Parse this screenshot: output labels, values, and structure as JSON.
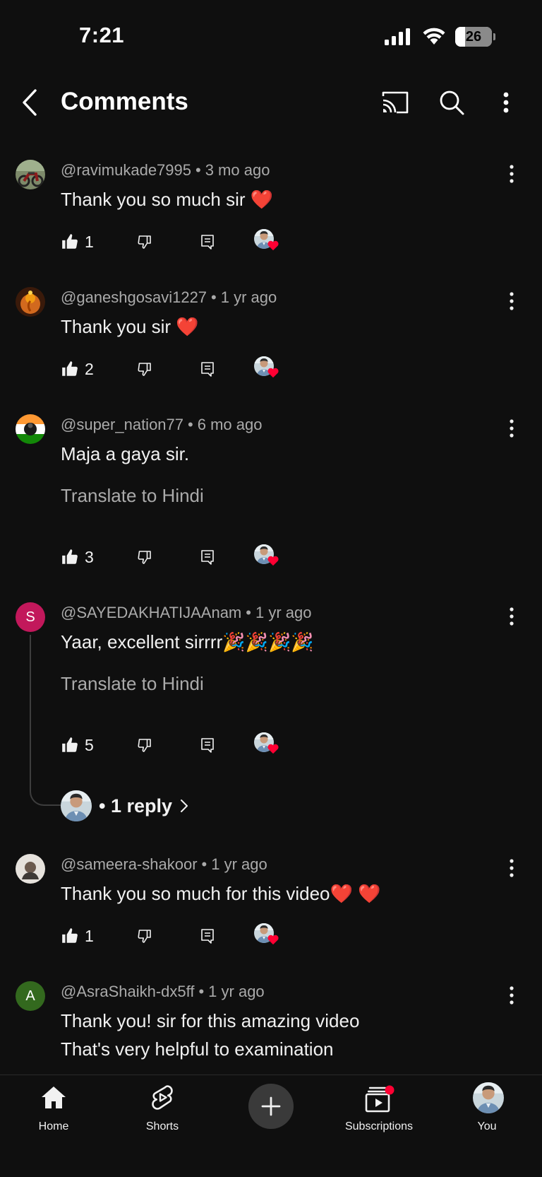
{
  "status_bar": {
    "time": "7:21",
    "battery_level": "26",
    "battery_fraction": 0.26
  },
  "header": {
    "title": "Comments",
    "icons": [
      "back-arrow-icon",
      "cast-icon",
      "search-icon",
      "more-vertical-icon"
    ]
  },
  "comments": [
    {
      "author": "@ravimukade7995",
      "age": "3 mo ago",
      "text": "Thank you so much sir ❤️",
      "likes": "1",
      "avatar": "motorbike-photo",
      "creator_hearted": true
    },
    {
      "author": "@ganeshgosavi1227",
      "age": "1 yr ago",
      "text": "Thank you sir ❤️",
      "likes": "2",
      "avatar": "ganesh-idol-photo",
      "creator_hearted": true
    },
    {
      "author": "@super_nation77",
      "age": "6 mo ago",
      "text": "Maja a gaya sir.",
      "translate": "Translate to Hindi",
      "likes": "3",
      "avatar": "indian-flag-photo",
      "creator_hearted": true
    },
    {
      "author": "@SAYEDAKHATIJAAnam",
      "age": "1 yr ago",
      "text": "Yaar, excellent sirrrr🎉🎉🎉🎉",
      "translate": "Translate to Hindi",
      "likes": "5",
      "avatar_letter": "S",
      "avatar_color": "#c2185b",
      "creator_hearted": true,
      "replies": "• 1 reply"
    },
    {
      "author": "@sameera-shakoor",
      "age": "1 yr ago",
      "text": "Thank you so much for this video❤️ ❤️",
      "likes": "1",
      "avatar": "person-photo",
      "creator_hearted": true
    },
    {
      "author": "@AsraShaikh-dx5ff",
      "age": "1 yr ago",
      "text_lines": [
        "Thank you! sir for this amazing video",
        "That's very helpful to examination"
      ],
      "avatar_letter": "A",
      "avatar_color": "#33691e"
    }
  ],
  "bottom_nav": {
    "items": [
      {
        "label": "Home",
        "icon": "home-icon"
      },
      {
        "label": "Shorts",
        "icon": "shorts-icon"
      },
      {
        "label": "",
        "icon": "plus-icon"
      },
      {
        "label": "Subscriptions",
        "icon": "subscriptions-icon"
      },
      {
        "label": "You",
        "icon": "profile-avatar"
      }
    ]
  },
  "colors": {
    "background": "#0f0f0f",
    "text_primary": "#f1f1f1",
    "text_secondary": "#aaaaaa",
    "heart_red": "#ff0033"
  }
}
